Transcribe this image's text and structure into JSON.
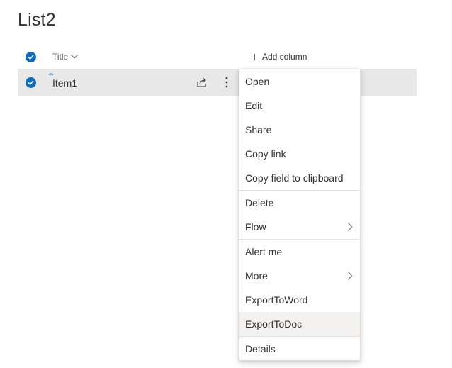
{
  "list": {
    "title": "List2"
  },
  "header": {
    "title_column": "Title",
    "add_column": "Add column"
  },
  "rows": [
    {
      "title": "Item1",
      "selected": true,
      "is_new": true
    }
  ],
  "context_menu": {
    "groups": [
      [
        {
          "label": "Open"
        },
        {
          "label": "Edit"
        },
        {
          "label": "Share"
        },
        {
          "label": "Copy link"
        },
        {
          "label": "Copy field to clipboard"
        }
      ],
      [
        {
          "label": "Delete"
        },
        {
          "label": "Flow",
          "submenu": true
        }
      ],
      [
        {
          "label": "Alert me"
        },
        {
          "label": "More",
          "submenu": true
        },
        {
          "label": "ExportToWord"
        },
        {
          "label": "ExportToDoc",
          "hovered": true
        }
      ],
      [
        {
          "label": "Details"
        }
      ]
    ]
  },
  "colors": {
    "accent": "#0f6cbd",
    "selected_row": "#e8e8e8",
    "menu_hover": "#f3f2f1",
    "text": "#323130"
  }
}
